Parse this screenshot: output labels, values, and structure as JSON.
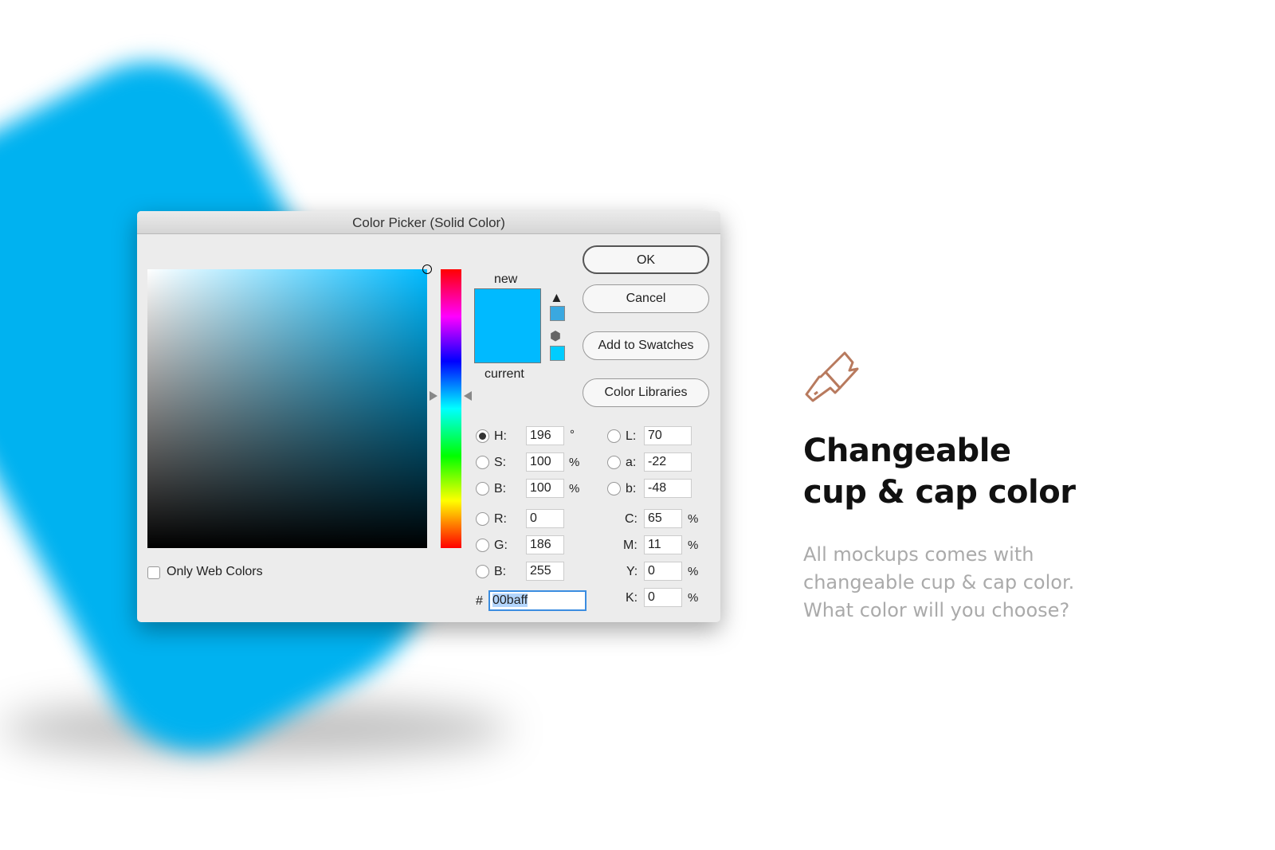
{
  "dialog": {
    "title": "Color Picker (Solid Color)",
    "new_label": "new",
    "current_label": "current",
    "new_color": "#00baff",
    "current_color": "#00baff",
    "gamut_warning_swatch": "#3aa8e0",
    "web_safe_swatch": "#00ccff",
    "buttons": {
      "ok": "OK",
      "cancel": "Cancel",
      "add": "Add to Swatches",
      "libraries": "Color Libraries"
    },
    "only_web": "Only Web Colors",
    "hsb": [
      {
        "label": "H:",
        "value": "196",
        "unit": "°",
        "selected": true
      },
      {
        "label": "S:",
        "value": "100",
        "unit": "%"
      },
      {
        "label": "B:",
        "value": "100",
        "unit": "%"
      }
    ],
    "rgb": [
      {
        "label": "R:",
        "value": "0"
      },
      {
        "label": "G:",
        "value": "186"
      },
      {
        "label": "B:",
        "value": "255"
      }
    ],
    "lab": [
      {
        "label": "L:",
        "value": "70"
      },
      {
        "label": "a:",
        "value": "-22"
      },
      {
        "label": "b:",
        "value": "-48"
      }
    ],
    "cmyk": [
      {
        "label": "C:",
        "value": "65",
        "unit": "%"
      },
      {
        "label": "M:",
        "value": "11",
        "unit": "%"
      },
      {
        "label": "Y:",
        "value": "0",
        "unit": "%"
      },
      {
        "label": "K:",
        "value": "0",
        "unit": "%"
      }
    ],
    "hex_label": "#",
    "hex": "00baff"
  },
  "promo": {
    "icon": "paintbrush-icon",
    "icon_color": "#b87a5e",
    "title_1": "Changeable",
    "title_2": "cup & cap color",
    "text_1": "All mockups comes with",
    "text_2": "changeable cup & cap color.",
    "text_3": "What color will you choose?"
  }
}
